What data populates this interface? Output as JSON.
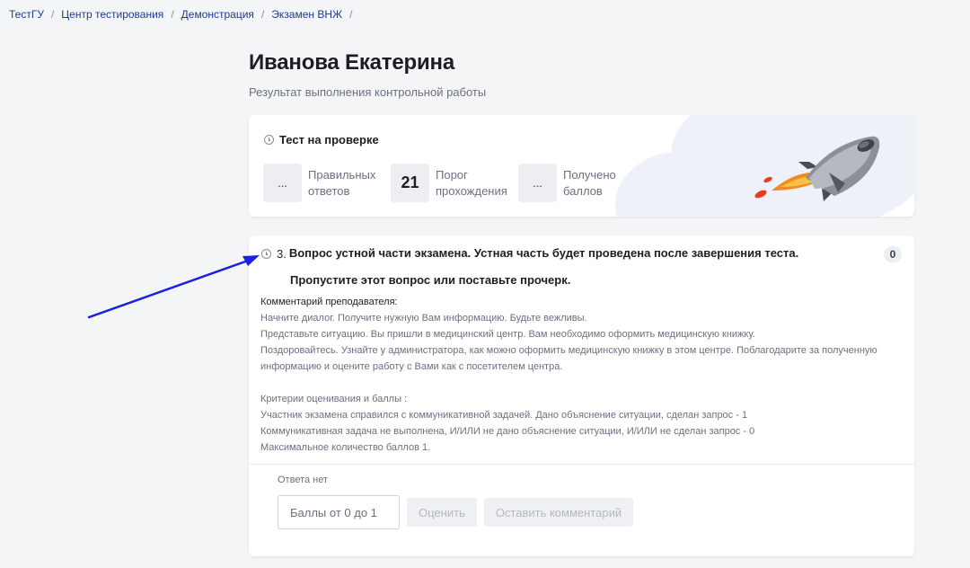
{
  "breadcrumb": {
    "items": [
      "ТестГУ",
      "Центр тестирования",
      "Демонстрация",
      "Экзамен ВНЖ"
    ],
    "separator": "/"
  },
  "page": {
    "title": "Иванова Екатерина",
    "subtitle": "Результат выполнения контрольной работы"
  },
  "summary": {
    "status": "Тест на проверке",
    "stats": [
      {
        "value": "...",
        "label": "Правильных ответов"
      },
      {
        "value": "21",
        "label": "Порог прохождения"
      },
      {
        "value": "...",
        "label": "Получено баллов"
      }
    ]
  },
  "question": {
    "number": "3.",
    "title": "Вопрос устной части экзамена. Устная часть будет проведена после завершения теста.",
    "subtitle": "Пропустите этот вопрос или поставьте прочерк.",
    "score_badge": "0",
    "comment_header": "Комментарий преподавателя:",
    "comment_lines": [
      "Начните диалог. Получите нужную Вам информацию. Будьте вежливы.",
      "Представьте ситуацию. Вы пришли в медицинский центр. Вам необходимо оформить медицинскую книжку.",
      "Поздоровайтесь. Узнайте у администратора, как можно оформить медицинскую книжку в этом центре. Поблагодарите за полученную",
      "информацию и оцените работу с Вами как с посетителем центра.",
      "",
      "Критерии оценивания и баллы :",
      "Участник экзамена справился с коммуникативной задачей. Дано объяснение ситуации, сделан запрос - 1",
      "Коммуникативная задача не выполнена, И/ИЛИ не дано объяснение ситуации, И/ИЛИ не сделан запрос - 0",
      "Максимальное количество баллов 1."
    ],
    "no_answer": "Ответа нет",
    "score_placeholder": "Баллы от 0 до 1",
    "evaluate_label": "Оценить",
    "comment_button_label": "Оставить комментарий"
  },
  "colors": {
    "accent": "#1d3b8f",
    "annotation_arrow": "#1a1ee6"
  }
}
